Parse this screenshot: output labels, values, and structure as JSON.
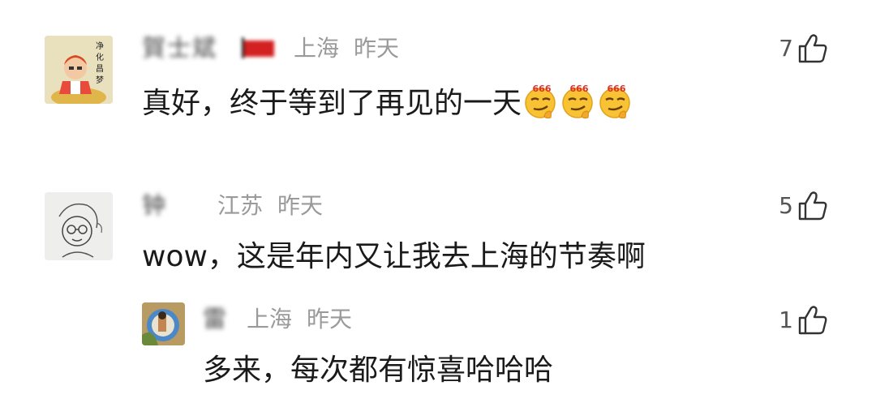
{
  "comments": [
    {
      "name": "賀士斌",
      "location": "上海",
      "time": "昨天",
      "text": "真好，终于等到了再见的一天",
      "likes": "7",
      "emoji_count_label": "666",
      "emoji": "smirk-666-emoji"
    },
    {
      "name": "钟",
      "location": "江苏",
      "time": "昨天",
      "text": "wow，这是年内又让我去上海的节奏啊",
      "likes": "5"
    },
    {
      "name": "雷",
      "location": "上海",
      "time": "昨天",
      "text": "多来，每次都有惊喜哈哈哈",
      "likes": "1"
    }
  ],
  "avatar_texts": [
    "净",
    "化",
    "昌",
    "梦"
  ],
  "icons": {
    "like": "thumbs-up-icon",
    "flag": "red-flag-icon"
  },
  "colors": {
    "meta": "#9a9a9a",
    "text": "#1a1a1a",
    "emoji_label": "#e0302a"
  }
}
